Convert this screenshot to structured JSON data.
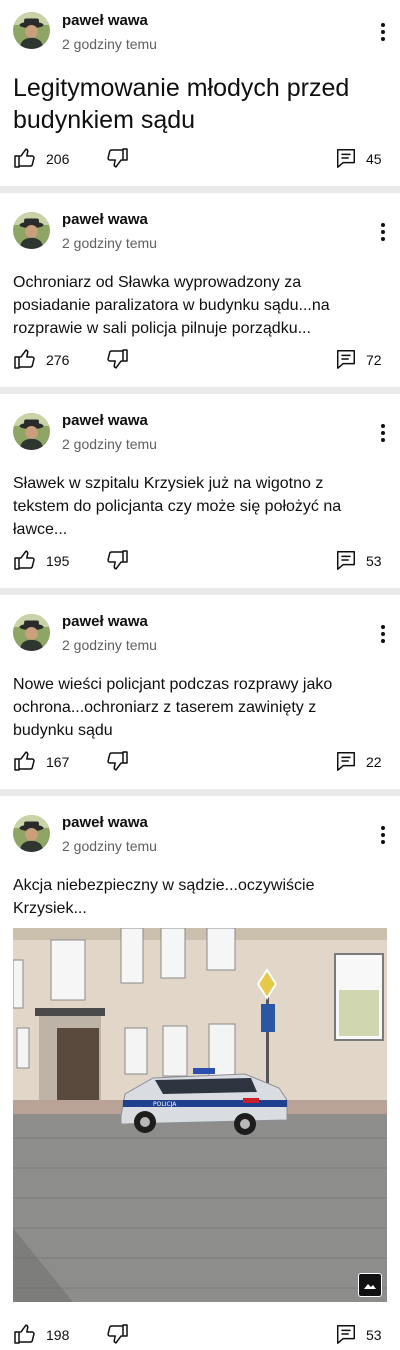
{
  "posts": [
    {
      "author": "paweł wawa",
      "time": "2 godziny temu",
      "text": "Legitymowanie młodych przed budynkiem sądu",
      "likes": "206",
      "comments": "45"
    },
    {
      "author": "paweł wawa",
      "time": "2 godziny temu",
      "text": "Ochroniarz od Sławka wyprowadzony za posiadanie paralizatora w budynku sądu...na rozprawie w sali policja pilnuje porządku...",
      "likes": "276",
      "comments": "72"
    },
    {
      "author": "paweł wawa",
      "time": "2 godziny temu",
      "text": "Sławek w szpitalu Krzysiek już na wigotno z tekstem do policjanta czy może się położyć na ławce...",
      "likes": "195",
      "comments": "53"
    },
    {
      "author": "paweł wawa",
      "time": "2 godziny temu",
      "text": "Nowe wieści policjant podczas rozprawy jako ochrona...ochroniarz z taserem zawinięty z budynku sądu",
      "likes": "167",
      "comments": "22"
    },
    {
      "author": "paweł wawa",
      "time": "2 godziny temu",
      "text": "Akcja niebezpieczny w sądzie...oczywiście Krzysiek...",
      "likes": "198",
      "comments": "53"
    }
  ],
  "photo": {
    "car_label": "POLICJA",
    "icons": {
      "badge": "image-icon"
    }
  },
  "icons": {
    "like": "thumb-up-icon",
    "dislike": "thumb-down-icon",
    "comment": "comment-icon",
    "more": "more-vert-icon"
  }
}
